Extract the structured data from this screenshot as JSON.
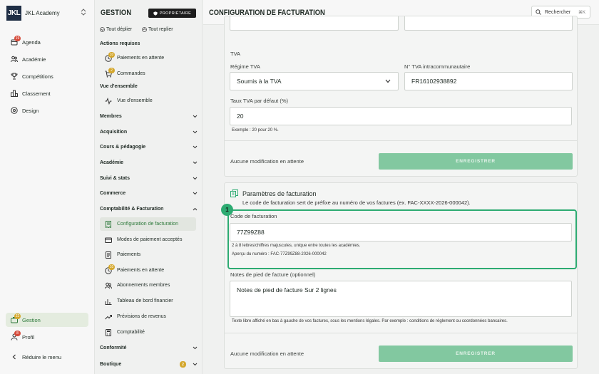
{
  "sidebar": {
    "logo_text": "JKL",
    "brand": "JKL Academy",
    "items": [
      {
        "label": "Agenda",
        "badge": "19"
      },
      {
        "label": "Académie"
      },
      {
        "label": "Compétitions"
      },
      {
        "label": "Classement"
      },
      {
        "label": "Design"
      }
    ],
    "gestion": {
      "label": "Gestion",
      "badge": "22"
    },
    "profil": {
      "label": "Profil",
      "badge": "8"
    },
    "collapse": "Réduire le menu"
  },
  "gestion_panel": {
    "title": "GESTION",
    "owner_badge": "PROPRIÉTAIRE",
    "expand_all": "Tout déplier",
    "collapse_all": "Tout replier",
    "actions_title": "Actions requises",
    "actions": [
      {
        "label": "Paiements en attente",
        "badge": "10"
      },
      {
        "label": "Commandes",
        "badge": "2"
      }
    ],
    "overview_title": "Vue d'ensemble",
    "overview_item": "Vue d'ensemble",
    "groups": [
      "Membres",
      "Acquisition",
      "Cours & pédagogie",
      "Académie",
      "Suivi & stats",
      "Commerce"
    ],
    "compta_group": "Comptabilité & Facturation",
    "compta_items": [
      {
        "label": "Configuration de facturation"
      },
      {
        "label": "Modes de paiement acceptés"
      },
      {
        "label": "Paiements"
      },
      {
        "label": "Paiements en attente",
        "badge": "10"
      },
      {
        "label": "Abonnements membres"
      },
      {
        "label": "Tableau de bord financier"
      },
      {
        "label": "Prévisions de revenus"
      },
      {
        "label": "Comptabilité"
      }
    ],
    "conformite": "Conformité",
    "boutique": {
      "label": "Boutique",
      "badge": "2"
    }
  },
  "header": {
    "title": "CONFIGURATION DE FACTURATION",
    "search_label": "Rechercher",
    "search_kbd": "⌘K"
  },
  "tva": {
    "section": "TVA",
    "regime_label": "Régime TVA",
    "regime_value": "Soumis à la TVA",
    "intra_label": "N° TVA intracommunautaire",
    "intra_value": "FR16102938892",
    "rate_label": "Taux TVA par défaut (%)",
    "rate_value": "20",
    "rate_hint": "Exemple : 20 pour 20 %.",
    "pending": "Aucune modification en attente",
    "save": "ENREGISTRER"
  },
  "billing": {
    "title": "Paramètres de facturation",
    "desc": "Le code de facturation sert de préfixe au numéro de vos factures (ex. FAC-XXXX-2026-000042).",
    "marker": "1",
    "code_label": "Code de facturation",
    "code_value": "77Z99Z88",
    "code_hint1": "2 à 8 lettres/chiffres majuscules, unique entre toutes les académies.",
    "code_hint2": "Aperçu du numéro : FAC-77Z99Z88-2026-000042",
    "notes_label": "Notes de pied de facture (optionnel)",
    "notes_value": "Notes de pied de facture Sur 2 lignes",
    "notes_hint": "Texte libre affiché en bas à gauche de vos factures, sous les mentions légales. Par exemple : conditions de règlement ou coordonnées bancaires.",
    "pending": "Aucune modification en attente",
    "save": "ENREGISTRER"
  },
  "colors": {
    "accent": "#2dab72",
    "save_bg": "#82c8a0",
    "badge_red": "#d64b3b",
    "badge_gold": "#d4a72c"
  }
}
